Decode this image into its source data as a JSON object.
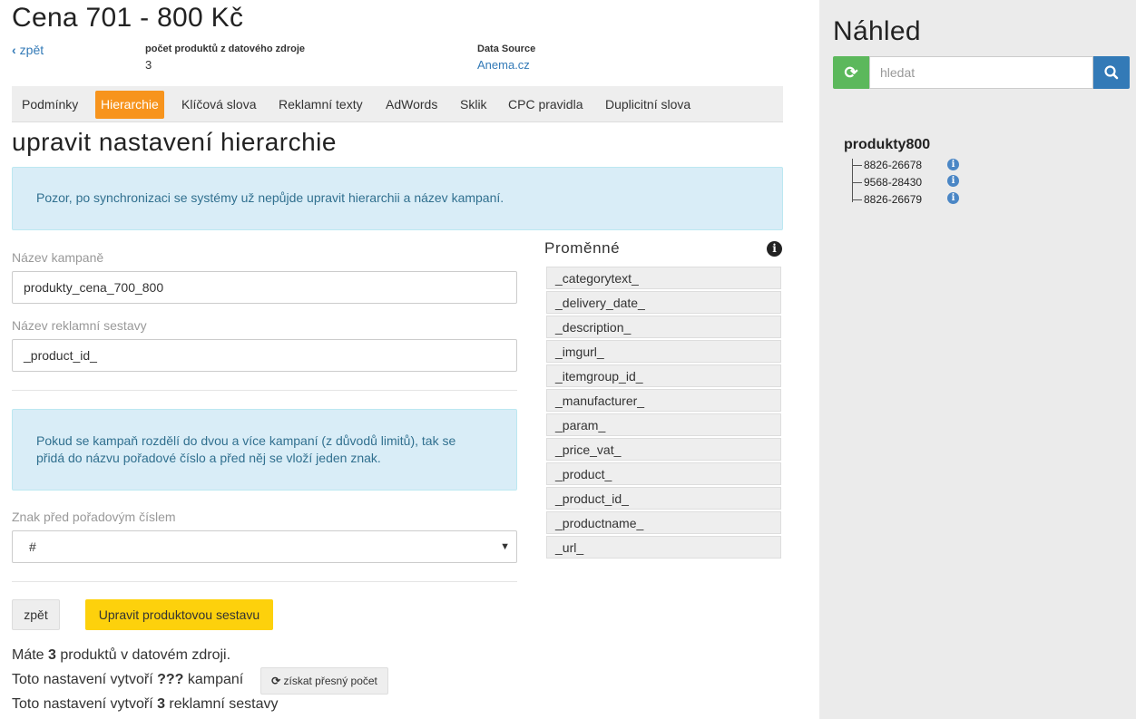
{
  "header": {
    "title": "Cena 701 - 800 Kč",
    "back_label": "zpět",
    "product_count_label": "počet produktů z datového zdroje",
    "product_count_value": "3",
    "data_source_label": "Data Source",
    "data_source_value": "Anema.cz"
  },
  "tabs": [
    {
      "label": "Podmínky"
    },
    {
      "label": "Hierarchie",
      "active": true
    },
    {
      "label": "Klíčová slova"
    },
    {
      "label": "Reklamní texty"
    },
    {
      "label": "AdWords"
    },
    {
      "label": "Sklik"
    },
    {
      "label": "CPC pravidla"
    },
    {
      "label": "Duplicitní slova"
    }
  ],
  "section_title": "upravit nastavení hierarchie",
  "warning_text": "Pozor, po synchronizaci se systémy už nepůjde upravit hierarchii a název kampaní.",
  "form": {
    "campaign_name_label": "Název kampaně",
    "campaign_name_value": "produkty_cena_700_800",
    "adgroup_name_label": "Název reklamní sestavy",
    "adgroup_name_value": "_product_id_",
    "split_info_line1": "Pokud se kampaň rozdělí do dvou a více kampaní (z důvodů limitů), tak se",
    "split_info_line2": "přidá do názvu pořadové číslo a před něj se vloží jeden znak.",
    "separator_label": "Znak před pořadovým číslem",
    "separator_value": "#",
    "back_button": "zpět",
    "submit_button": "Upravit produktovou sestavu"
  },
  "variables": {
    "title": "Proměnné",
    "items": [
      "_categorytext_",
      "_delivery_date_",
      "_description_",
      "_imgurl_",
      "_itemgroup_id_",
      "_manufacturer_",
      "_param_",
      "_price_vat_",
      "_product_",
      "_product_id_",
      "_productname_",
      "_url_"
    ]
  },
  "stats": {
    "line1_pre": "Máte ",
    "line1_bold": "3",
    "line1_post": " produktů v datovém zdroji.",
    "line2_pre": "Toto nastavení vytvoří ",
    "line2_bold": "???",
    "line2_post": " kampaní",
    "count_button": "získat přesný počet",
    "line3_pre": "Toto nastavení vytvoří ",
    "line3_bold": "3",
    "line3_post": " reklamní sestavy"
  },
  "preview": {
    "title": "Náhled",
    "search_placeholder": "hledat",
    "tree_root": "produkty800",
    "tree_items": [
      "8826-26678",
      "9568-28430",
      "8826-26679"
    ]
  },
  "colors": {
    "accent": "#f7941d",
    "primary": "#337ab7",
    "success": "#5cb85c",
    "warning_btn": "#fdd10c",
    "info_bg": "#d9edf7"
  }
}
